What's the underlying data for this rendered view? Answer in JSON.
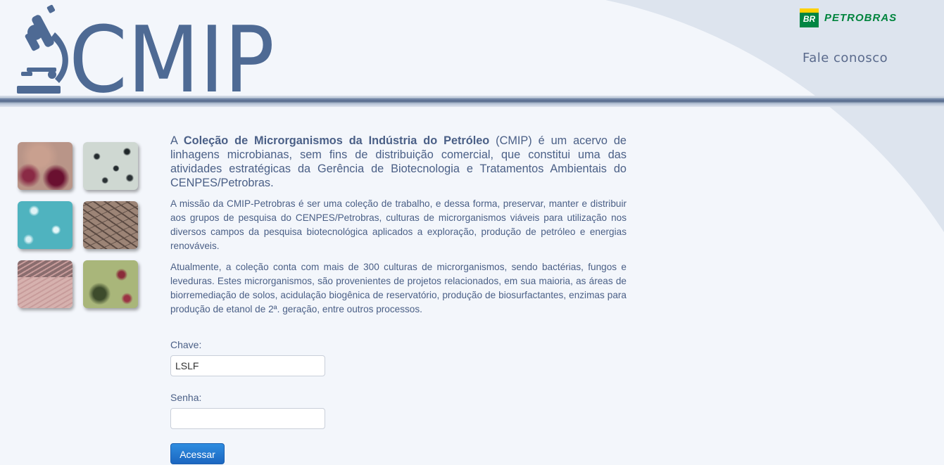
{
  "header": {
    "logo_text": "CMIP",
    "brand_badge": "BR",
    "brand_name": "PETROBRAS",
    "contact_link": "Fale conosco"
  },
  "gallery": {
    "images": [
      {
        "name": "red-cells-micrograph"
      },
      {
        "name": "dark-rods-micrograph"
      },
      {
        "name": "turquoise-stain-micrograph"
      },
      {
        "name": "fungal-hyphae-micrograph"
      },
      {
        "name": "pink-colony-micrograph"
      },
      {
        "name": "green-red-micrograph"
      }
    ]
  },
  "content": {
    "intro_a": "A ",
    "intro_bold": "Coleção de Microrganismos da Indústria do Petróleo",
    "intro_rest": " (CMIP) é um acervo de linhagens microbianas, sem fins de distribuição comercial, que constitui uma das atividades estratégicas da Gerência de Biotecnologia e Tratamentos Ambientais do CENPES/Petrobras.",
    "paragraph_1": "A missão da CMIP-Petrobras é ser uma coleção de trabalho, e dessa forma, preservar, manter e distribuir aos grupos de pesquisa do CENPES/Petrobras, culturas de microrganismos viáveis para utilização nos diversos campos da pesquisa biotecnológica aplicados a exploração, produção de petróleo e energias renováveis.",
    "paragraph_2": "Atualmente, a coleção conta com mais de 300 culturas de microrganismos, sendo bactérias, fungos e leveduras. Estes microrganismos, são provenientes de projetos relacionados, em sua maioria, as áreas de biorremediação de solos, acidulação biogênica de reservatório, produção de biosurfactantes, enzimas para produção de etanol de 2ª. geração, entre outros processos."
  },
  "login": {
    "key_label": "Chave:",
    "key_value": "LSLF",
    "password_label": "Senha:",
    "password_value": "",
    "submit_label": "Acessar"
  }
}
